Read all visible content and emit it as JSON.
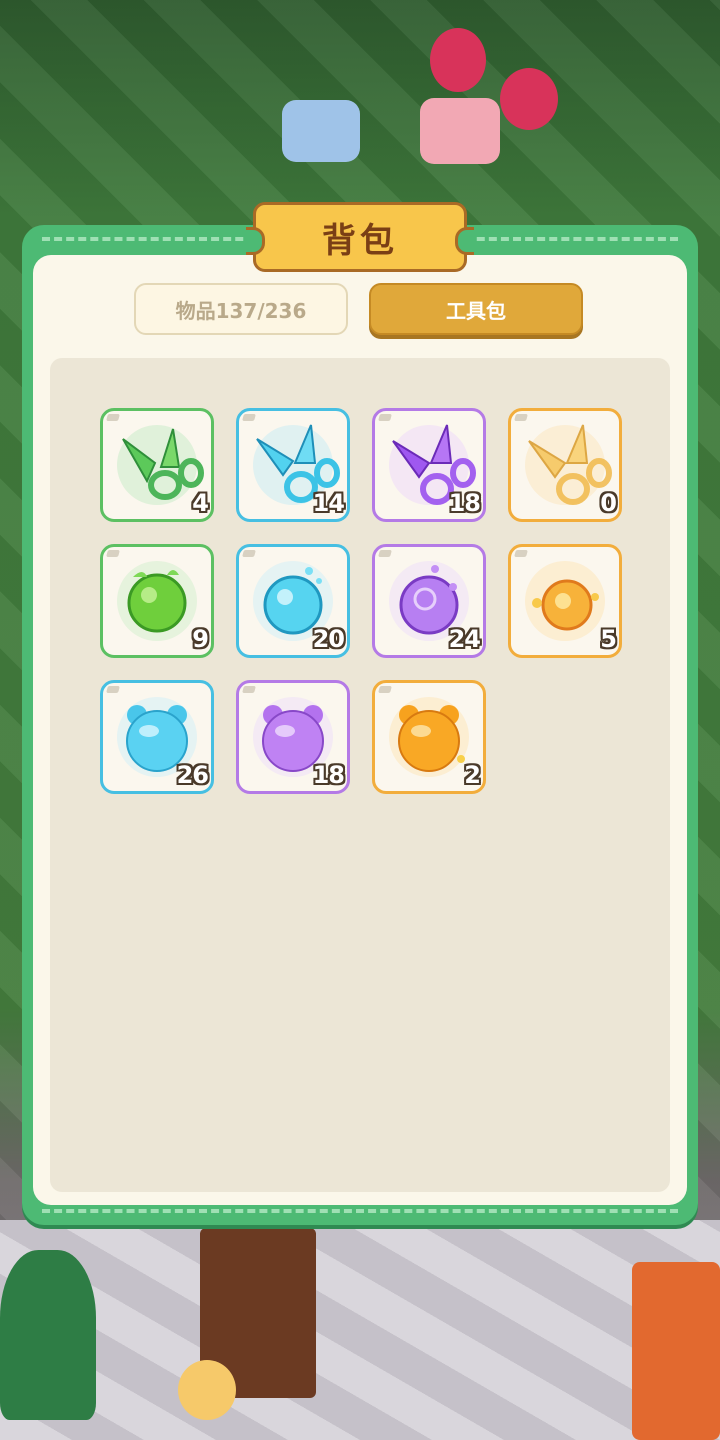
{
  "window": {
    "title": "背包"
  },
  "tabs": {
    "items_label": "物品137/236",
    "tools_label": "工具包",
    "active": "tools"
  },
  "colors": {
    "panel_green": "#4dba74",
    "panel_cream": "#fbf7ea",
    "title_gold": "#f8c64b",
    "active_tab": "#e0a83a",
    "rarity_green": "#5cc062",
    "rarity_blue": "#46bfe2",
    "rarity_purple": "#b47ae6",
    "rarity_orange": "#f2ad3c"
  },
  "items": [
    {
      "icon": "green-scissors-icon",
      "rarity": "green",
      "count": "4"
    },
    {
      "icon": "blue-scissors-icon",
      "rarity": "blue",
      "count": "14"
    },
    {
      "icon": "purple-scissors-icon",
      "rarity": "purple",
      "count": "18"
    },
    {
      "icon": "gold-scissors-icon",
      "rarity": "orange",
      "count": "0"
    },
    {
      "icon": "green-orb-icon",
      "rarity": "green",
      "count": "9"
    },
    {
      "icon": "blue-orb-icon",
      "rarity": "blue",
      "count": "20"
    },
    {
      "icon": "purple-orb-icon",
      "rarity": "purple",
      "count": "24"
    },
    {
      "icon": "gold-orb-icon",
      "rarity": "orange",
      "count": "5"
    },
    {
      "icon": "blue-jelly-bear-icon",
      "rarity": "blue",
      "count": "26"
    },
    {
      "icon": "purple-jelly-bear-icon",
      "rarity": "purple",
      "count": "18"
    },
    {
      "icon": "orange-jelly-bear-icon",
      "rarity": "orange",
      "count": "2"
    }
  ]
}
